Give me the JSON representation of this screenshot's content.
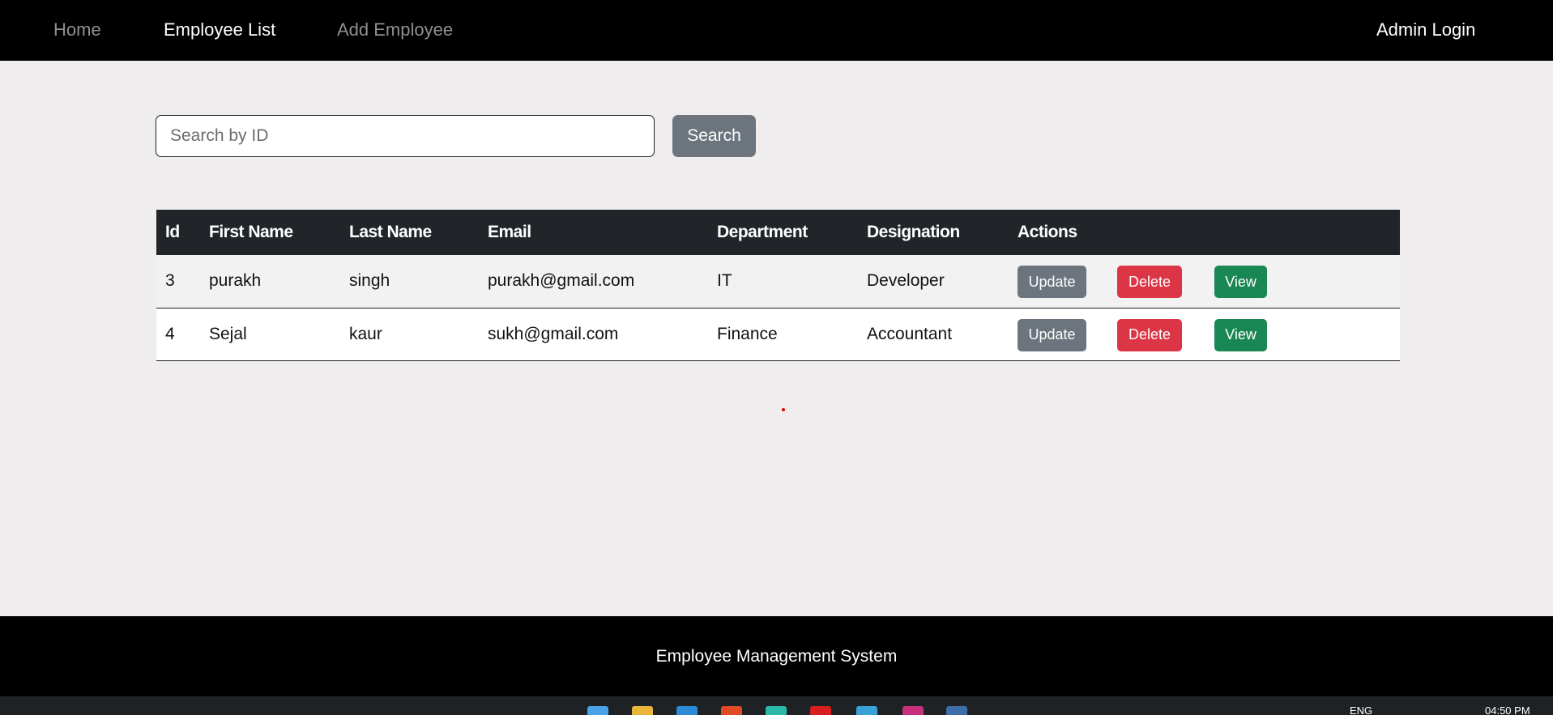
{
  "navbar": {
    "home_label": "Home",
    "employee_list_label": "Employee List",
    "add_employee_label": "Add Employee",
    "admin_login_label": "Admin Login"
  },
  "search": {
    "placeholder": "Search by ID",
    "value": "",
    "button_label": "Search"
  },
  "table": {
    "headers": {
      "id": "Id",
      "first_name": "First Name",
      "last_name": "Last Name",
      "email": "Email",
      "department": "Department",
      "designation": "Designation",
      "actions": "Actions"
    },
    "rows": [
      {
        "id": "3",
        "first_name": "purakh",
        "last_name": "singh",
        "email": "purakh@gmail.com",
        "department": "IT",
        "designation": "Developer"
      },
      {
        "id": "4",
        "first_name": "Sejal",
        "last_name": "kaur",
        "email": "sukh@gmail.com",
        "department": "Finance",
        "designation": "Accountant"
      }
    ],
    "action_labels": {
      "update": "Update",
      "delete": "Delete",
      "view": "View"
    }
  },
  "footer": {
    "text": "Employee Management System"
  },
  "taskbar": {
    "language": "ENG",
    "time": "04:50 PM",
    "icons": [
      "windows-start-icon",
      "file-explorer-icon",
      "vscode-icon",
      "brave-browser-icon",
      "edge-icon",
      "acrobat-icon",
      "store-icon",
      "instagram-icon",
      "app-icon"
    ]
  },
  "colors": {
    "navbar_bg": "#000000",
    "page_bg": "#efeded",
    "table_header_bg": "#212529",
    "update_btn": "#6c757d",
    "delete_btn": "#dc3545",
    "view_btn": "#198754",
    "search_btn": "#6c757d"
  }
}
